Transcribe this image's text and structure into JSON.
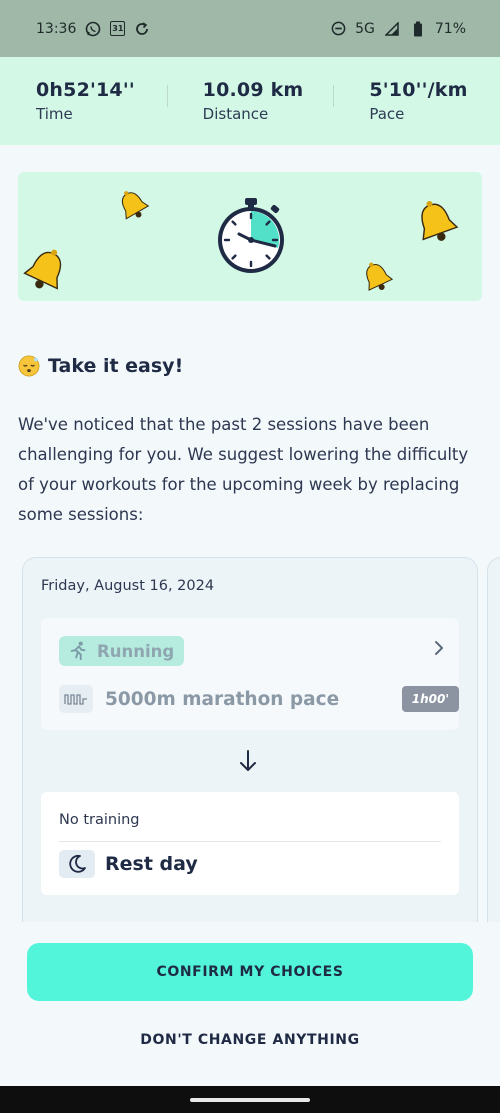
{
  "status_bar": {
    "time": "13:36",
    "network": "5G",
    "battery": "71%",
    "icons": [
      "whatsapp-icon",
      "calendar-icon",
      "sync-icon",
      "dnd-icon",
      "signal-icon",
      "battery-icon"
    ],
    "calendar_day": "31"
  },
  "stats": [
    {
      "value": "0h52'14''",
      "label": "Time"
    },
    {
      "value": "10.09 km",
      "label": "Distance"
    },
    {
      "value": "5'10''/km",
      "label": "Pace"
    }
  ],
  "heading": {
    "emoji": "sleeping-face-icon",
    "title": "Take it easy!"
  },
  "description": "We've noticed that the past 2 sessions have been challenging for you. We suggest lowering the difficulty of your workouts for the upcoming week by replacing some sessions:",
  "card": {
    "date": "Friday, August 16, 2024",
    "session": {
      "sport": "Running",
      "workout": "5000m marathon pace",
      "duration": "1h00'"
    },
    "replacement": {
      "label": "No training",
      "name": "Rest day"
    }
  },
  "buttons": {
    "confirm": "CONFIRM MY CHOICES",
    "dont_change": "DON'T CHANGE ANYTHING"
  },
  "colors": {
    "accent": "#52f5da",
    "header_bg": "#d3f9e6",
    "text_dark": "#1f2a44"
  }
}
